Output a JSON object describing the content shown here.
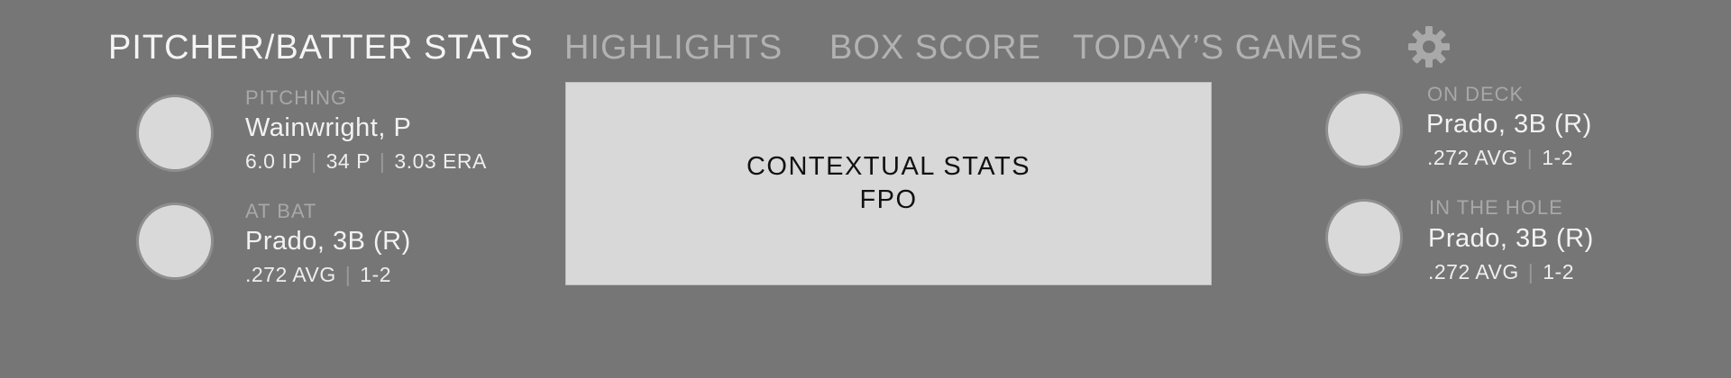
{
  "nav": {
    "tabs": [
      {
        "label": "PITCHER/BATTER STATS",
        "active": true
      },
      {
        "label": "HIGHLIGHTS",
        "active": false
      },
      {
        "label": "BOX SCORE",
        "active": false
      },
      {
        "label": "TODAY’S GAMES",
        "active": false
      }
    ],
    "settings_icon": "gear-icon"
  },
  "colors": {
    "background": "#767676",
    "tab_active": "#f5f5f5",
    "tab_inactive": "#b2b2b2",
    "avatar_fill": "#d9d9d9",
    "context_fill": "#d8d8d8"
  },
  "pitching": {
    "role": "PITCHING",
    "name": "Wainwright, P",
    "stats": [
      "6.0 IP",
      "34 P",
      "3.03 ERA"
    ]
  },
  "at_bat": {
    "role": "AT BAT",
    "name": "Prado, 3B (R)",
    "stats": [
      ".272 AVG",
      "1-2"
    ]
  },
  "on_deck": {
    "role": "ON DECK",
    "name": "Prado, 3B (R)",
    "stats": [
      ".272 AVG",
      "1-2"
    ]
  },
  "in_the_hole": {
    "role": "IN THE HOLE",
    "name": "Prado, 3B (R)",
    "stats": [
      ".272 AVG",
      "1-2"
    ]
  },
  "context": {
    "line1": "CONTEXTUAL STATS",
    "line2": "FPO"
  }
}
